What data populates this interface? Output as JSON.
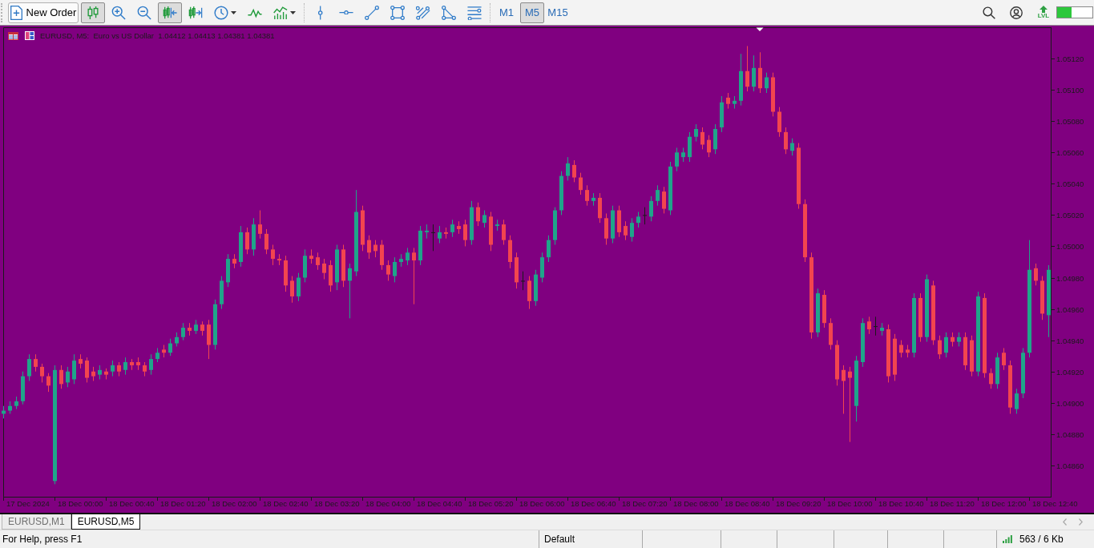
{
  "toolbar": {
    "new_order": "New Order",
    "chart_tools": [
      {
        "kind": "candlesticks",
        "selected": true
      },
      {
        "kind": "zoom_in",
        "selected": false
      },
      {
        "kind": "zoom_out",
        "selected": false
      },
      {
        "kind": "chart_shift",
        "selected": true
      },
      {
        "kind": "autoscroll",
        "selected": false
      },
      {
        "kind": "periods",
        "selected": false
      },
      {
        "kind": "line_chart",
        "selected": false
      },
      {
        "kind": "indicators",
        "selected": false
      }
    ],
    "timeframes": [
      {
        "label": "M1",
        "selected": false
      },
      {
        "label": "M5",
        "selected": true
      },
      {
        "label": "M15",
        "selected": false
      }
    ],
    "level_badge": "LVL",
    "meter": {
      "level": 0.42
    }
  },
  "chart": {
    "chart_data": {
      "type": "candlestick",
      "title": "EURUSD, M5:  Euro vs US Dollar  1.04412 1.04413 1.04381 1.04381",
      "categories": [
        null,
        null,
        null,
        null,
        "17 Dec 2024",
        null,
        null,
        null,
        null,
        null,
        null,
        null,
        "18 Dec 00:00",
        null,
        null,
        null,
        null,
        null,
        null,
        null,
        "18 Dec 00:40",
        null,
        null,
        null,
        null,
        null,
        null,
        null,
        "18 Dec 01:20",
        null,
        null,
        null,
        null,
        null,
        null,
        null,
        "18 Dec 02:00",
        null,
        null,
        null,
        null,
        null,
        null,
        null,
        "18 Dec 02:40",
        null,
        null,
        null,
        null,
        null,
        null,
        null,
        "18 Dec 03:20",
        null,
        null,
        null,
        null,
        null,
        null,
        null,
        "18 Dec 04:00",
        null,
        null,
        null,
        null,
        null,
        null,
        null,
        "18 Dec 04:40",
        null,
        null,
        null,
        null,
        null,
        null,
        null,
        "18 Dec 05:20",
        null,
        null,
        null,
        null,
        null,
        null,
        null,
        "18 Dec 06:00",
        null,
        null,
        null,
        null,
        null,
        null,
        null,
        "18 Dec 06:40",
        null,
        null,
        null,
        null,
        null,
        null,
        null,
        "18 Dec 07:20",
        null,
        null,
        null,
        null,
        null,
        null,
        null,
        "18 Dec 08:00",
        null,
        null,
        null,
        null,
        null,
        null,
        null,
        "18 Dec 08:40",
        null,
        null,
        null,
        null,
        null,
        null,
        null,
        "18 Dec 09:20",
        null,
        null,
        null,
        null,
        null,
        null,
        null,
        "18 Dec 10:00",
        null,
        null,
        null,
        null,
        null,
        null,
        null,
        "18 Dec 10:40",
        null,
        null,
        null,
        null,
        null,
        null,
        null,
        "18 Dec 11:20",
        null,
        null,
        null,
        null,
        null,
        null,
        null,
        "18 Dec 12:00",
        null,
        null,
        null,
        null,
        null,
        null,
        null,
        "18 Dec 12:40"
      ],
      "ohlc": [
        [
          1.04893,
          1.04898,
          1.0489,
          1.04895
        ],
        [
          1.04895,
          1.04901,
          1.04893,
          1.04898
        ],
        [
          1.04898,
          1.04904,
          1.04896,
          1.04901
        ],
        [
          1.04901,
          1.0492,
          1.04899,
          1.04917
        ],
        [
          1.04917,
          1.04931,
          1.04914,
          1.04928
        ],
        [
          1.04928,
          1.04931,
          1.0492,
          1.04923
        ],
        [
          1.04923,
          1.04925,
          1.04913,
          1.04917
        ],
        [
          1.04917,
          1.04919,
          1.04907,
          1.04911
        ],
        [
          1.0485,
          1.04924,
          1.04848,
          1.04921
        ],
        [
          1.04921,
          1.04924,
          1.04909,
          1.04912
        ],
        [
          1.04913,
          1.04923,
          1.0491,
          1.0492
        ],
        [
          1.04915,
          1.04931,
          1.04912,
          1.04927
        ],
        [
          1.04928,
          1.04931,
          1.04922,
          1.04925
        ],
        [
          1.04927,
          1.04929,
          1.04913,
          1.04916
        ],
        [
          1.0492,
          1.04923,
          1.04914,
          1.04917
        ],
        [
          1.04918,
          1.04924,
          1.04915,
          1.04921
        ],
        [
          1.0492,
          1.04922,
          1.04915,
          1.04918
        ],
        [
          1.0492,
          1.04927,
          1.04917,
          1.04924
        ],
        [
          1.04924,
          1.04926,
          1.04917,
          1.0492
        ],
        [
          1.04921,
          1.04929,
          1.04918,
          1.04926
        ],
        [
          1.04926,
          1.04928,
          1.04921,
          1.04924
        ],
        [
          1.04926,
          1.04929,
          1.04921,
          1.04924
        ],
        [
          1.04924,
          1.04926,
          1.04917,
          1.0492
        ],
        [
          1.04921,
          1.04931,
          1.04918,
          1.04928
        ],
        [
          1.04928,
          1.04935,
          1.04926,
          1.04932
        ],
        [
          1.04934,
          1.04937,
          1.04929,
          1.04932
        ],
        [
          1.04932,
          1.04941,
          1.0493,
          1.04938
        ],
        [
          1.04938,
          1.04945,
          1.04936,
          1.04942
        ],
        [
          1.04942,
          1.04951,
          1.0494,
          1.04948
        ],
        [
          1.04948,
          1.04951,
          1.04943,
          1.04946
        ],
        [
          1.04946,
          1.04953,
          1.04944,
          1.0495
        ],
        [
          1.0495,
          1.04952,
          1.04943,
          1.04946
        ],
        [
          1.0495,
          1.04953,
          1.04928,
          1.04937
        ],
        [
          1.04937,
          1.04966,
          1.04934,
          1.04963
        ],
        [
          1.04963,
          1.04981,
          1.0496,
          1.04978
        ],
        [
          1.04977,
          1.04995,
          1.04974,
          1.04992
        ],
        [
          1.04992,
          1.04995,
          1.04986,
          1.04989
        ],
        [
          1.0499,
          1.05013,
          1.04987,
          1.05009
        ],
        [
          1.05009,
          1.05012,
          1.04995,
          1.04998
        ],
        [
          1.04998,
          1.05018,
          1.04994,
          1.05014
        ],
        [
          1.05014,
          1.05023,
          1.05005,
          1.05008
        ],
        [
          1.05008,
          1.05011,
          1.04995,
          1.04998
        ],
        [
          1.04998,
          1.05001,
          1.04988,
          1.04992
        ],
        [
          1.04992,
          1.04995,
          1.04988,
          1.04991
        ],
        [
          1.04991,
          1.04994,
          1.04971,
          1.04975
        ],
        [
          1.04978,
          1.04981,
          1.04964,
          1.04968
        ],
        [
          1.04968,
          1.04983,
          1.04965,
          1.0498
        ],
        [
          1.0498,
          1.04998,
          1.04977,
          1.04994
        ],
        [
          1.04994,
          1.04998,
          1.04989,
          1.04992
        ],
        [
          1.04993,
          1.04996,
          1.04985,
          1.04988
        ],
        [
          1.04989,
          1.04992,
          1.04979,
          1.04983
        ],
        [
          1.04988,
          1.04991,
          1.04971,
          1.04975
        ],
        [
          1.04977,
          1.05001,
          1.04972,
          1.04998
        ],
        [
          1.04998,
          1.05001,
          1.04974,
          1.04978
        ],
        [
          1.04978,
          1.04989,
          1.04954,
          1.04986
        ],
        [
          1.04984,
          1.05036,
          1.04981,
          1.05022
        ],
        [
          1.05023,
          1.05026,
          1.04997,
          1.05001
        ],
        [
          1.05004,
          1.05007,
          1.04992,
          1.04996
        ],
        [
          1.05001,
          1.05004,
          1.04993,
          1.04997
        ],
        [
          1.05001,
          1.05004,
          1.04985,
          1.04988
        ],
        [
          1.04988,
          1.04991,
          1.04978,
          1.04982
        ],
        [
          1.04981,
          1.04993,
          1.04977,
          1.0499
        ],
        [
          1.0499,
          1.04995,
          1.04987,
          1.04992
        ],
        [
          1.04991,
          1.04999,
          1.04988,
          1.04996
        ],
        [
          1.04996,
          1.04999,
          1.04963,
          1.04991
        ],
        [
          1.04991,
          1.05013,
          1.04988,
          1.0501
        ],
        [
          1.05009,
          1.05014,
          1.05005,
          1.0501
        ],
        [
          1.05009,
          1.05014,
          1.04997,
          1.05009
        ],
        [
          1.05005,
          1.05013,
          1.05002,
          1.05009
        ],
        [
          1.05009,
          1.05012,
          1.05005,
          1.05008
        ],
        [
          1.05009,
          1.05017,
          1.05006,
          1.05014
        ],
        [
          1.05013,
          1.05016,
          1.05008,
          1.05011
        ],
        [
          1.05014,
          1.05017,
          1.05,
          1.05004
        ],
        [
          1.05004,
          1.05029,
          1.05001,
          1.05025
        ],
        [
          1.05025,
          1.05028,
          1.05013,
          1.05016
        ],
        [
          1.05015,
          1.05023,
          1.05012,
          1.0502
        ],
        [
          1.05019,
          1.05022,
          1.04997,
          1.05001
        ],
        [
          1.05013,
          1.05017,
          1.0501,
          1.05014
        ],
        [
          1.05014,
          1.05017,
          1.05001,
          1.05004
        ],
        [
          1.05004,
          1.05007,
          1.04986,
          1.0499
        ],
        [
          1.04993,
          1.04996,
          1.04973,
          1.04977
        ],
        [
          1.04978,
          1.04984,
          1.04972,
          1.04978
        ],
        [
          1.04978,
          1.04981,
          1.0496,
          1.04965
        ],
        [
          1.04965,
          1.04985,
          1.04962,
          1.04982
        ],
        [
          1.0498,
          1.04996,
          1.04977,
          1.04993
        ],
        [
          1.04993,
          1.05007,
          1.0499,
          1.05004
        ],
        [
          1.05004,
          1.05025,
          1.05001,
          1.05023
        ],
        [
          1.05023,
          1.05048,
          1.0502,
          1.05045
        ],
        [
          1.05045,
          1.05057,
          1.05042,
          1.05053
        ],
        [
          1.05052,
          1.05055,
          1.05041,
          1.05044
        ],
        [
          1.05044,
          1.05047,
          1.05033,
          1.05036
        ],
        [
          1.05036,
          1.05039,
          1.05026,
          1.05029
        ],
        [
          1.05029,
          1.05034,
          1.05026,
          1.05031
        ],
        [
          1.05031,
          1.05034,
          1.05015,
          1.05018
        ],
        [
          1.05018,
          1.05021,
          1.05001,
          1.05005
        ],
        [
          1.05005,
          1.05026,
          1.05002,
          1.05023
        ],
        [
          1.05023,
          1.05026,
          1.05006,
          1.05009
        ],
        [
          1.05013,
          1.05016,
          1.05004,
          1.05007
        ],
        [
          1.05006,
          1.05018,
          1.05003,
          1.05015
        ],
        [
          1.05015,
          1.05022,
          1.05012,
          1.05019
        ],
        [
          1.0502,
          1.05025,
          1.05014,
          1.0502
        ],
        [
          1.05019,
          1.05032,
          1.05016,
          1.05029
        ],
        [
          1.05029,
          1.05039,
          1.05026,
          1.05036
        ],
        [
          1.05035,
          1.05038,
          1.05021,
          1.05024
        ],
        [
          1.05023,
          1.05054,
          1.0502,
          1.05051
        ],
        [
          1.05051,
          1.05063,
          1.05048,
          1.0506
        ],
        [
          1.05057,
          1.05063,
          1.05054,
          1.0506
        ],
        [
          1.05057,
          1.05073,
          1.05054,
          1.0507
        ],
        [
          1.0507,
          1.05078,
          1.05067,
          1.05075
        ],
        [
          1.05073,
          1.05076,
          1.05062,
          1.05065
        ],
        [
          1.05068,
          1.05071,
          1.05057,
          1.0506
        ],
        [
          1.05062,
          1.05078,
          1.05059,
          1.05075
        ],
        [
          1.05076,
          1.05096,
          1.05073,
          1.05092
        ],
        [
          1.05095,
          1.05098,
          1.05088,
          1.05091
        ],
        [
          1.05091,
          1.05096,
          1.05088,
          1.05093
        ],
        [
          1.05093,
          1.05123,
          1.0509,
          1.05112
        ],
        [
          1.05112,
          1.05128,
          1.05099,
          1.05102
        ],
        [
          1.05102,
          1.05122,
          1.05099,
          1.05114
        ],
        [
          1.05114,
          1.05124,
          1.05098,
          1.05101
        ],
        [
          1.05101,
          1.05111,
          1.05098,
          1.05108
        ],
        [
          1.05108,
          1.05111,
          1.05083,
          1.05086
        ],
        [
          1.05086,
          1.05089,
          1.0507,
          1.05073
        ],
        [
          1.05073,
          1.05076,
          1.05059,
          1.05062
        ],
        [
          1.05061,
          1.05069,
          1.05058,
          1.05066
        ],
        [
          1.05063,
          1.05066,
          1.05024,
          1.05027
        ],
        [
          1.05027,
          1.0503,
          1.0499,
          1.04993
        ],
        [
          1.04993,
          1.04996,
          1.04941,
          1.04945
        ],
        [
          1.04945,
          1.04973,
          1.04942,
          1.0497
        ],
        [
          1.04969,
          1.04972,
          1.04948,
          1.04951
        ],
        [
          1.04951,
          1.04954,
          1.04934,
          1.04937
        ],
        [
          1.04937,
          1.0494,
          1.04911,
          1.04915
        ],
        [
          1.04921,
          1.04924,
          1.04893,
          1.04914
        ],
        [
          1.0492,
          1.04923,
          1.04875,
          1.04916
        ],
        [
          1.04898,
          1.0493,
          1.04888,
          1.04927
        ],
        [
          1.04926,
          1.04954,
          1.04923,
          1.04951
        ],
        [
          1.04952,
          1.04955,
          1.04944,
          1.04947
        ],
        [
          1.04949,
          1.04955,
          1.04943,
          1.04949
        ],
        [
          1.04946,
          1.04951,
          1.04943,
          1.04948
        ],
        [
          1.04947,
          1.0495,
          1.04913,
          1.04917
        ],
        [
          1.04941,
          1.04944,
          1.04914,
          1.04918
        ],
        [
          1.04937,
          1.0494,
          1.04929,
          1.04932
        ],
        [
          1.04934,
          1.04937,
          1.04929,
          1.04932
        ],
        [
          1.04932,
          1.0497,
          1.04929,
          1.04967
        ],
        [
          1.04967,
          1.0497,
          1.04939,
          1.04942
        ],
        [
          1.04942,
          1.04982,
          1.04939,
          1.04979
        ],
        [
          1.04975,
          1.04978,
          1.04937,
          1.0494
        ],
        [
          1.0494,
          1.04943,
          1.04928,
          1.04931
        ],
        [
          1.04932,
          1.04945,
          1.04929,
          1.04942
        ],
        [
          1.04942,
          1.04945,
          1.04936,
          1.04939
        ],
        [
          1.04939,
          1.04945,
          1.04936,
          1.04942
        ],
        [
          1.04942,
          1.04945,
          1.04921,
          1.04924
        ],
        [
          1.0494,
          1.04943,
          1.04917,
          1.0492
        ],
        [
          1.0492,
          1.04971,
          1.04917,
          1.04968
        ],
        [
          1.04967,
          1.0497,
          1.04916,
          1.04919
        ],
        [
          1.04919,
          1.04922,
          1.04909,
          1.04912
        ],
        [
          1.04912,
          1.04932,
          1.04909,
          1.04929
        ],
        [
          1.04932,
          1.04935,
          1.04921,
          1.04924
        ],
        [
          1.04924,
          1.04927,
          1.04893,
          1.04897
        ],
        [
          1.04896,
          1.04909,
          1.04893,
          1.04906
        ],
        [
          1.04906,
          1.04935,
          1.04903,
          1.04932
        ],
        [
          1.04932,
          1.05004,
          1.04929,
          1.04985
        ],
        [
          1.04986,
          1.04989,
          1.04975,
          1.04978
        ],
        [
          1.04978,
          1.04981,
          1.04953,
          1.04957
        ],
        [
          1.04956,
          1.04988,
          1.04942,
          1.04985
        ],
        null
      ],
      "ylim": [
        1.0484,
        1.0514
      ],
      "yticks": [
        {
          "value": 1.0512,
          "label": "1.05120"
        },
        {
          "value": 1.051,
          "label": "1.05100"
        },
        {
          "value": 1.0508,
          "label": "1.05080"
        },
        {
          "value": 1.0506,
          "label": "1.05060"
        },
        {
          "value": 1.0504,
          "label": "1.05040"
        },
        {
          "value": 1.0502,
          "label": "1.05020"
        },
        {
          "value": 1.05,
          "label": "1.05000"
        },
        {
          "value": 1.0498,
          "label": "1.04980"
        },
        {
          "value": 1.0496,
          "label": "1.04960"
        },
        {
          "value": 1.0494,
          "label": "1.04940"
        },
        {
          "value": 1.0492,
          "label": "1.04920"
        },
        {
          "value": 1.049,
          "label": "1.04900"
        },
        {
          "value": 1.0488,
          "label": "1.04880"
        },
        {
          "value": 1.0486,
          "label": "1.04860"
        }
      ]
    }
  },
  "tabs": [
    {
      "label": "EURUSD,M1",
      "selected": false
    },
    {
      "label": "EURUSD,M5",
      "selected": true
    }
  ],
  "status_bar": {
    "help": "For Help, press F1",
    "profile": "Default",
    "traffic": "563 / 6 Kb"
  }
}
